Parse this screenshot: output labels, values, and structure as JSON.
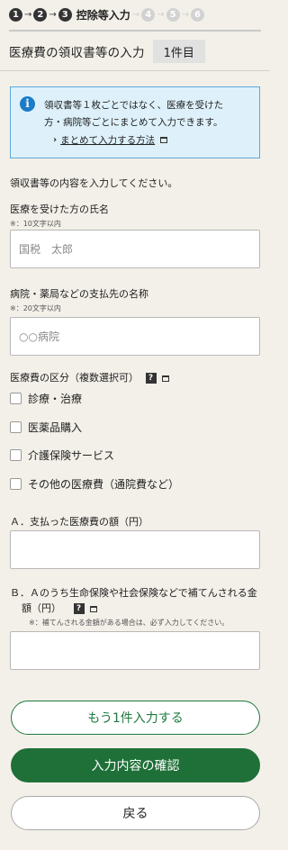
{
  "steps": {
    "items": [
      {
        "number": "1",
        "state": "done"
      },
      {
        "number": "2",
        "state": "done"
      },
      {
        "number": "3",
        "state": "current",
        "label": "控除等入力"
      },
      {
        "number": "4",
        "state": "future"
      },
      {
        "number": "5",
        "state": "future"
      },
      {
        "number": "6",
        "state": "future"
      }
    ],
    "arrow": "→"
  },
  "header": {
    "title": "医療費の領収書等の入力",
    "count_badge": "1件目"
  },
  "info": {
    "icon": "info-icon",
    "line1": "領収書等１枚ごとではなく、医療を受けた",
    "line2": "方・病院等ごとにまとめて入力できます。",
    "link_chevron": "›",
    "link_text": "まとめて入力する方法"
  },
  "form": {
    "intro": "領収書等の内容を入力してください。",
    "patient_name": {
      "label": "医療を受けた方の氏名",
      "hint": "※：10文字以内",
      "placeholder": "国税　太郎"
    },
    "payee_name": {
      "label": "病院・薬局などの支払先の名称",
      "hint": "※：20文字以内",
      "placeholder": "○○病院"
    },
    "category": {
      "label": "医療費の区分（複数選択可）",
      "help": "?",
      "options": [
        {
          "label": "診療・治療",
          "checked": false
        },
        {
          "label": "医薬品購入",
          "checked": false
        },
        {
          "label": "介護保険サービス",
          "checked": false
        },
        {
          "label": "その他の医療費（通院費など）",
          "checked": false
        }
      ]
    },
    "amount_paid": {
      "label": "Ａ．支払った医療費の額（円）",
      "value": ""
    },
    "reimbursed": {
      "label_line1": "Ｂ．Ａのうち生命保険や社会保険などで補てんされる金",
      "label_line2": "額（円）",
      "help": "?",
      "hint": "※：補てんされる金額がある場合は、必ず入力してください。",
      "value": ""
    }
  },
  "buttons": {
    "add_another": "もう1件入力する",
    "confirm": "入力内容の確認",
    "back": "戻る"
  },
  "colors": {
    "primary_green": "#1f7038",
    "info_bg": "#def1fb",
    "info_border": "#5ca9d8",
    "page_bg": "#f3f0e9"
  }
}
